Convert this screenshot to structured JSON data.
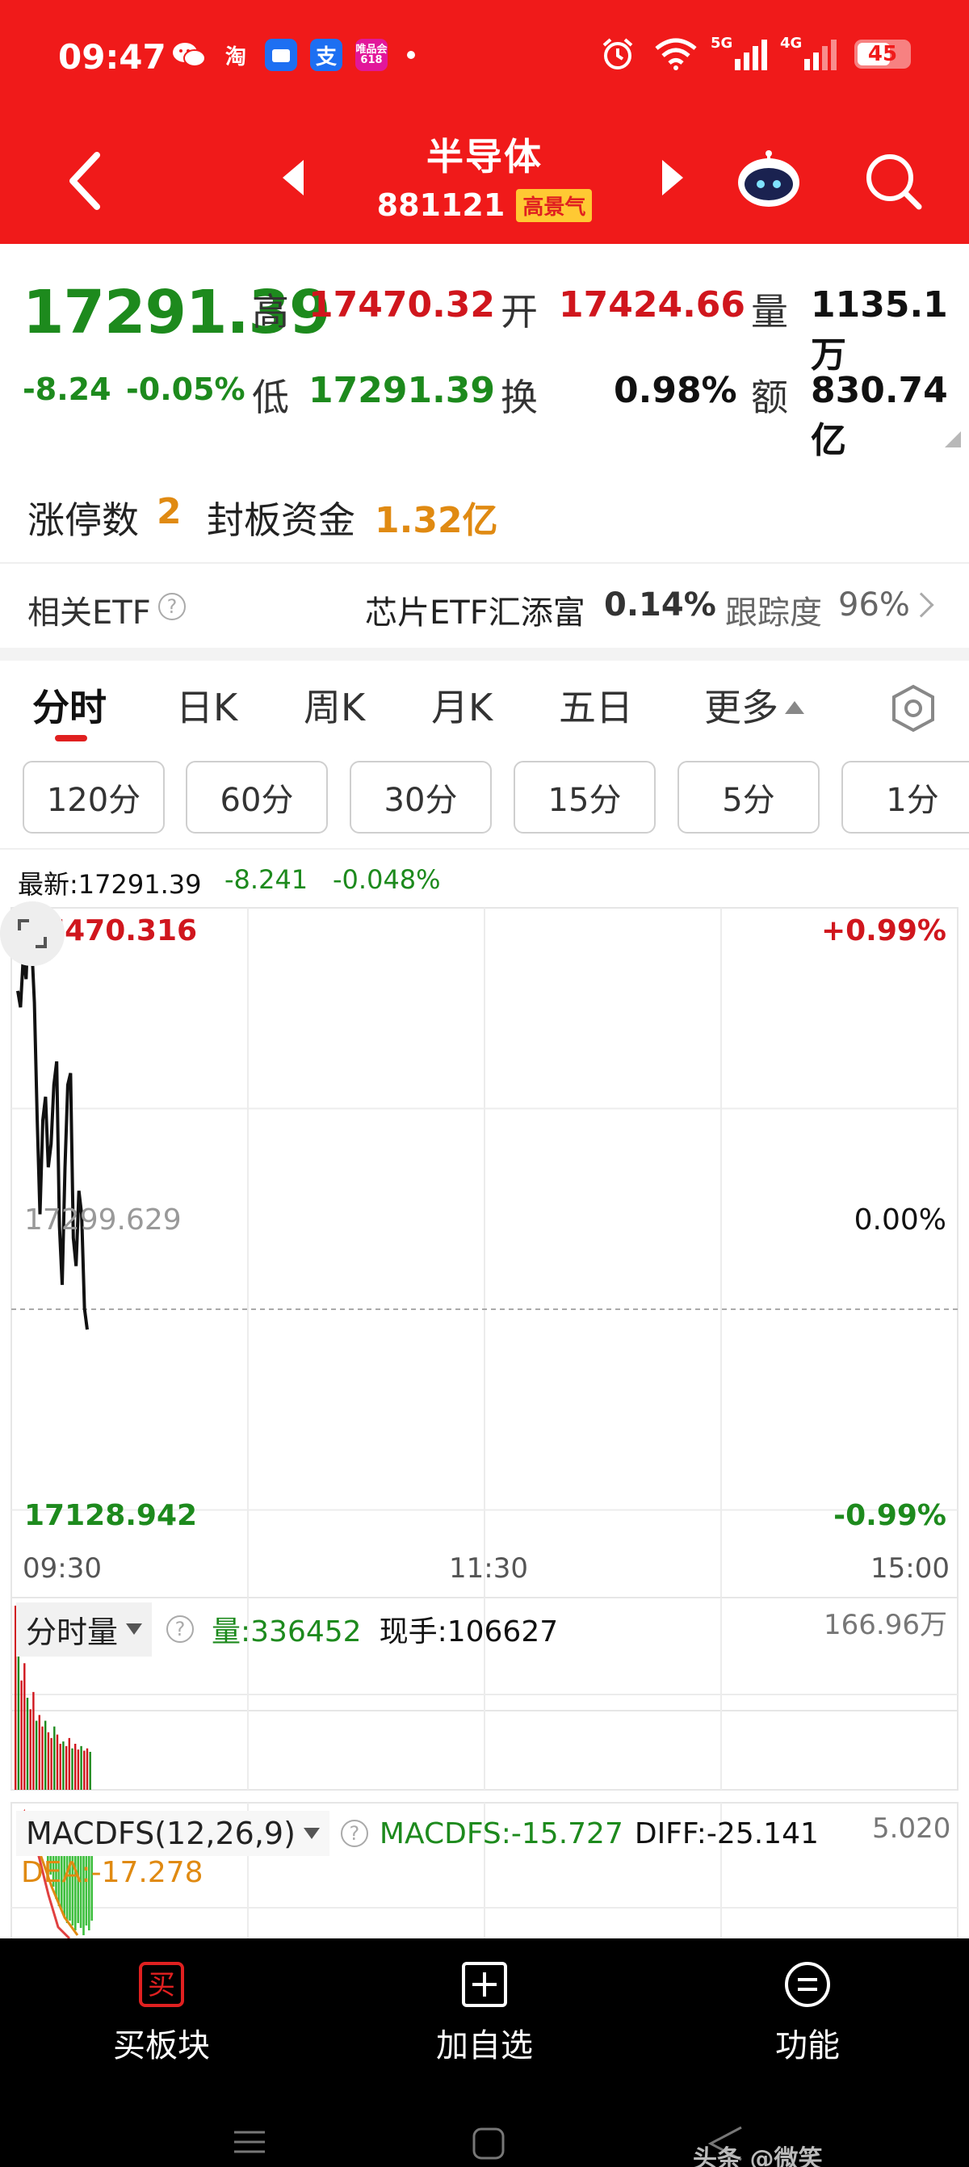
{
  "status_bar": {
    "time": "09:47",
    "apps": [
      "wechat-icon",
      "taobao-icon",
      "tv-app-icon",
      "alipay-icon",
      "shopping-app-icon"
    ],
    "taobao_glyph": "淘",
    "alipay_glyph": "支",
    "shop_app_text": "唯品会 618",
    "sig1_label": "5G",
    "sig2_label": "4G",
    "battery": "45"
  },
  "header": {
    "title": "半导体",
    "code": "881121",
    "badge": "高景气",
    "bg_color": "#f01a1a"
  },
  "quote": {
    "price": "17291.39",
    "change": "-8.24",
    "change_pct": "-0.05%",
    "high_label": "高",
    "high": "17470.32",
    "open_label": "开",
    "open": "17424.66",
    "volume_label": "量",
    "volume": "1135.1万",
    "low_label": "低",
    "low": "17291.39",
    "turnover_label": "换",
    "turnover": "0.98%",
    "amount_label": "额",
    "amount": "830.74亿"
  },
  "limit": {
    "count_label": "涨停数",
    "count": "2",
    "funds_label": "封板资金",
    "funds": "1.32亿"
  },
  "etf": {
    "label": "相关ETF",
    "name": "芯片ETF汇添富",
    "pct": "0.14%",
    "tracking_label": "跟踪度",
    "tracking": "96%"
  },
  "tabs": {
    "items": [
      "分时",
      "日K",
      "周K",
      "月K",
      "五日",
      "更多"
    ],
    "active": "分时"
  },
  "periods": [
    "120分",
    "60分",
    "30分",
    "15分",
    "5分",
    "1分"
  ],
  "latest": {
    "label": "最新:17291.39",
    "change": "-8.241",
    "pct": "-0.048%"
  },
  "chart": {
    "y_high": "17470.316",
    "y_mid": "17299.629",
    "y_low": "17128.942",
    "pct_high": "+0.99%",
    "pct_mid": "0.00%",
    "pct_low": "-0.99%",
    "t_start": "09:30",
    "t_mid": "11:30",
    "t_end": "15:00"
  },
  "chart_data": {
    "type": "line",
    "ylim": [
      17128.942,
      17470.316
    ],
    "baseline": 17299.629,
    "x_ticks": [
      "09:30",
      "11:30",
      "15:00"
    ],
    "price_series": [
      17435,
      17428,
      17450,
      17440,
      17470,
      17455,
      17430,
      17380,
      17340,
      17380,
      17390,
      17360,
      17370,
      17395,
      17405,
      17335,
      17310,
      17360,
      17395,
      17400,
      17330,
      17318,
      17350,
      17340,
      17300,
      17291
    ],
    "volume_max_label": "166.96万",
    "volume_values": [
      160,
      120,
      95,
      110,
      80,
      70,
      85,
      60,
      65,
      55,
      60,
      50,
      45,
      55,
      48,
      40,
      42,
      38,
      45,
      36,
      40,
      35,
      38,
      34,
      36,
      33
    ],
    "macd_bars": [
      -20,
      -25,
      -30,
      -35,
      -38,
      -40,
      -42,
      -45,
      -44,
      -46,
      -48,
      -45,
      -47,
      -50,
      -46,
      -48,
      -44
    ]
  },
  "volume_panel": {
    "selector": "分时量",
    "volume_text": "量:336452",
    "hand_text": "现手:106627",
    "max_label": "166.96万"
  },
  "macd_panel": {
    "selector": "MACDFS(12,26,9)",
    "macdfs_text": "MACDFS:-15.727",
    "diff_text": "DIFF:-25.141",
    "dea_text": "DEA:-17.278",
    "max_label": "5.020"
  },
  "bottom_bar": {
    "buy_icon_glyph": "买",
    "buy_label": "买板块",
    "add_label": "加自选",
    "func_label": "功能"
  },
  "watermark": "头条 @微笑"
}
